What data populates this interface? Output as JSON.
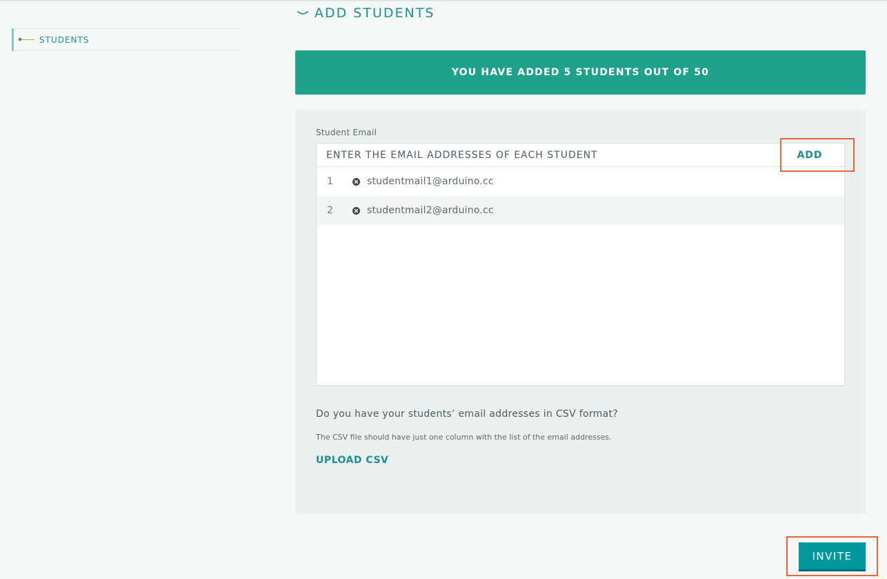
{
  "sidebar": {
    "items": [
      {
        "label": "STUDENTS",
        "icon": "timeline-node-icon"
      }
    ]
  },
  "section": {
    "title": "ADD STUDENTS",
    "toggle_icon": "chevron-down-icon"
  },
  "banner": {
    "text": "YOU HAVE ADDED 5 STUDENTS OUT OF 50",
    "color": "#1fa18b"
  },
  "form": {
    "label": "Student Email",
    "input_placeholder": "ENTER THE EMAIL ADDRESSES OF EACH STUDENT",
    "input_value": "",
    "add_label": "ADD",
    "emails": [
      {
        "index": "1",
        "email": "studentmail1@arduino.cc"
      },
      {
        "index": "2",
        "email": "studentmail2@arduino.cc"
      }
    ]
  },
  "csv": {
    "question": "Do you have your students’ email addresses in CSV format?",
    "note": "The CSV file should have just one column with the list of the email addresses.",
    "upload_label": "UPLOAD CSV"
  },
  "actions": {
    "invite_label": "INVITE"
  },
  "colors": {
    "accent": "#1b8f96",
    "invite_button": "#00979d",
    "highlight": "#e8683a"
  }
}
